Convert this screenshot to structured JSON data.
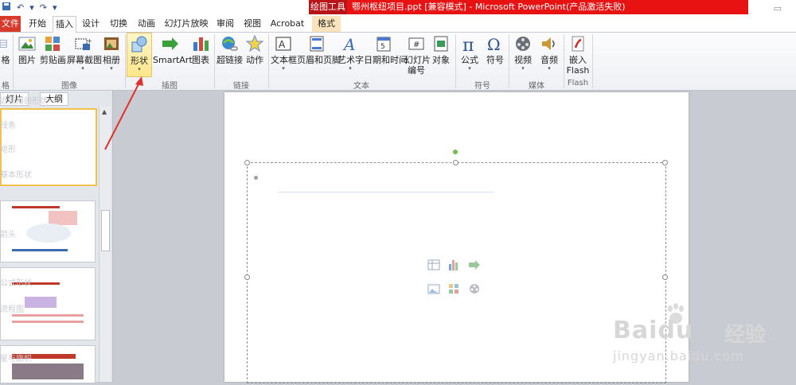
{
  "colors": {
    "title_red": "#e81212",
    "context_tab": "#b8151b",
    "file_tab": "#d73a2a",
    "highlight": "#fde68a",
    "annotation": "#e0302a"
  },
  "window": {
    "context_tool": "绘图工具",
    "doc_title": "鄂州枢纽项目.ppt [兼容模式] - Microsoft PowerPoint(产品激活失败)"
  },
  "tabs": {
    "file": "文件",
    "items": [
      "开始",
      "插入",
      "设计",
      "切换",
      "动画",
      "幻灯片放映",
      "审阅",
      "视图",
      "Acrobat",
      "格式"
    ],
    "active": "插入"
  },
  "ribbon": {
    "buttons": {
      "table": "格",
      "picture": "图片",
      "clipart": "剪贴画",
      "screenshot": "屏幕截图",
      "album": "相册",
      "shapes": "形状",
      "smartart": "SmartArt",
      "chart": "图表",
      "hyperlink": "超链接",
      "action": "动作",
      "textbox": "文本框",
      "header_footer": "页眉和页脚",
      "wordart": "艺术字",
      "datetime": "日期和时间",
      "slidenum_1": "幻灯片",
      "slidenum_2": "编号",
      "object": "对象",
      "equation": "公式",
      "symbol": "符号",
      "video": "视频",
      "audio": "音频",
      "embed_1": "嵌入",
      "embed_2": "Flash"
    },
    "groups": {
      "table": "格",
      "images": "图像",
      "illustrations": "插图",
      "links": "链接",
      "text": "文本",
      "symbols": "符号",
      "media": "媒体",
      "flash": "Flash"
    }
  },
  "left_panel": {
    "tab_slides": "灯片",
    "tab_outline": "大纲",
    "shape_headers": [
      "近使用的形状",
      "线条",
      "矩形",
      "基本形状",
      "箭头",
      "公式形状",
      "流程图",
      "星与旗帜"
    ]
  },
  "watermark": {
    "brand": "Baidu",
    "cn": "经验",
    "url": "jingyan.baidu.com"
  }
}
